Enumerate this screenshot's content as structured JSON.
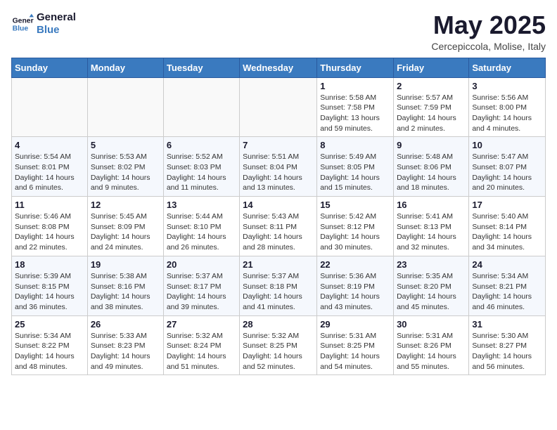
{
  "header": {
    "logo_line1": "General",
    "logo_line2": "Blue",
    "month_title": "May 2025",
    "subtitle": "Cercepiccola, Molise, Italy"
  },
  "weekdays": [
    "Sunday",
    "Monday",
    "Tuesday",
    "Wednesday",
    "Thursday",
    "Friday",
    "Saturday"
  ],
  "weeks": [
    [
      {
        "day": "",
        "info": ""
      },
      {
        "day": "",
        "info": ""
      },
      {
        "day": "",
        "info": ""
      },
      {
        "day": "",
        "info": ""
      },
      {
        "day": "1",
        "info": "Sunrise: 5:58 AM\nSunset: 7:58 PM\nDaylight: 13 hours\nand 59 minutes."
      },
      {
        "day": "2",
        "info": "Sunrise: 5:57 AM\nSunset: 7:59 PM\nDaylight: 14 hours\nand 2 minutes."
      },
      {
        "day": "3",
        "info": "Sunrise: 5:56 AM\nSunset: 8:00 PM\nDaylight: 14 hours\nand 4 minutes."
      }
    ],
    [
      {
        "day": "4",
        "info": "Sunrise: 5:54 AM\nSunset: 8:01 PM\nDaylight: 14 hours\nand 6 minutes."
      },
      {
        "day": "5",
        "info": "Sunrise: 5:53 AM\nSunset: 8:02 PM\nDaylight: 14 hours\nand 9 minutes."
      },
      {
        "day": "6",
        "info": "Sunrise: 5:52 AM\nSunset: 8:03 PM\nDaylight: 14 hours\nand 11 minutes."
      },
      {
        "day": "7",
        "info": "Sunrise: 5:51 AM\nSunset: 8:04 PM\nDaylight: 14 hours\nand 13 minutes."
      },
      {
        "day": "8",
        "info": "Sunrise: 5:49 AM\nSunset: 8:05 PM\nDaylight: 14 hours\nand 15 minutes."
      },
      {
        "day": "9",
        "info": "Sunrise: 5:48 AM\nSunset: 8:06 PM\nDaylight: 14 hours\nand 18 minutes."
      },
      {
        "day": "10",
        "info": "Sunrise: 5:47 AM\nSunset: 8:07 PM\nDaylight: 14 hours\nand 20 minutes."
      }
    ],
    [
      {
        "day": "11",
        "info": "Sunrise: 5:46 AM\nSunset: 8:08 PM\nDaylight: 14 hours\nand 22 minutes."
      },
      {
        "day": "12",
        "info": "Sunrise: 5:45 AM\nSunset: 8:09 PM\nDaylight: 14 hours\nand 24 minutes."
      },
      {
        "day": "13",
        "info": "Sunrise: 5:44 AM\nSunset: 8:10 PM\nDaylight: 14 hours\nand 26 minutes."
      },
      {
        "day": "14",
        "info": "Sunrise: 5:43 AM\nSunset: 8:11 PM\nDaylight: 14 hours\nand 28 minutes."
      },
      {
        "day": "15",
        "info": "Sunrise: 5:42 AM\nSunset: 8:12 PM\nDaylight: 14 hours\nand 30 minutes."
      },
      {
        "day": "16",
        "info": "Sunrise: 5:41 AM\nSunset: 8:13 PM\nDaylight: 14 hours\nand 32 minutes."
      },
      {
        "day": "17",
        "info": "Sunrise: 5:40 AM\nSunset: 8:14 PM\nDaylight: 14 hours\nand 34 minutes."
      }
    ],
    [
      {
        "day": "18",
        "info": "Sunrise: 5:39 AM\nSunset: 8:15 PM\nDaylight: 14 hours\nand 36 minutes."
      },
      {
        "day": "19",
        "info": "Sunrise: 5:38 AM\nSunset: 8:16 PM\nDaylight: 14 hours\nand 38 minutes."
      },
      {
        "day": "20",
        "info": "Sunrise: 5:37 AM\nSunset: 8:17 PM\nDaylight: 14 hours\nand 39 minutes."
      },
      {
        "day": "21",
        "info": "Sunrise: 5:37 AM\nSunset: 8:18 PM\nDaylight: 14 hours\nand 41 minutes."
      },
      {
        "day": "22",
        "info": "Sunrise: 5:36 AM\nSunset: 8:19 PM\nDaylight: 14 hours\nand 43 minutes."
      },
      {
        "day": "23",
        "info": "Sunrise: 5:35 AM\nSunset: 8:20 PM\nDaylight: 14 hours\nand 45 minutes."
      },
      {
        "day": "24",
        "info": "Sunrise: 5:34 AM\nSunset: 8:21 PM\nDaylight: 14 hours\nand 46 minutes."
      }
    ],
    [
      {
        "day": "25",
        "info": "Sunrise: 5:34 AM\nSunset: 8:22 PM\nDaylight: 14 hours\nand 48 minutes."
      },
      {
        "day": "26",
        "info": "Sunrise: 5:33 AM\nSunset: 8:23 PM\nDaylight: 14 hours\nand 49 minutes."
      },
      {
        "day": "27",
        "info": "Sunrise: 5:32 AM\nSunset: 8:24 PM\nDaylight: 14 hours\nand 51 minutes."
      },
      {
        "day": "28",
        "info": "Sunrise: 5:32 AM\nSunset: 8:25 PM\nDaylight: 14 hours\nand 52 minutes."
      },
      {
        "day": "29",
        "info": "Sunrise: 5:31 AM\nSunset: 8:25 PM\nDaylight: 14 hours\nand 54 minutes."
      },
      {
        "day": "30",
        "info": "Sunrise: 5:31 AM\nSunset: 8:26 PM\nDaylight: 14 hours\nand 55 minutes."
      },
      {
        "day": "31",
        "info": "Sunrise: 5:30 AM\nSunset: 8:27 PM\nDaylight: 14 hours\nand 56 minutes."
      }
    ]
  ]
}
